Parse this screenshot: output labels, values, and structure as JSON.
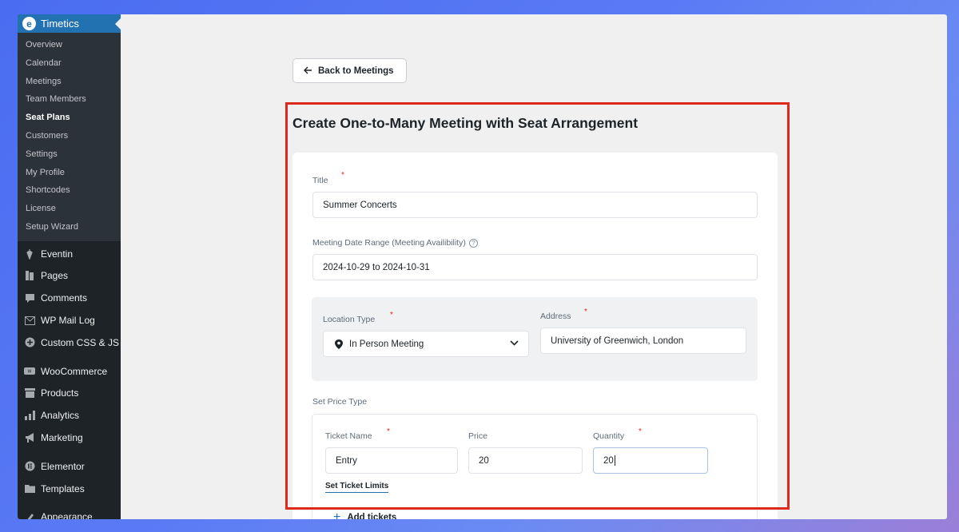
{
  "sidebar": {
    "brand": "Timetics",
    "submenu": [
      {
        "label": "Overview",
        "active": false
      },
      {
        "label": "Calendar",
        "active": false
      },
      {
        "label": "Meetings",
        "active": false
      },
      {
        "label": "Team Members",
        "active": false
      },
      {
        "label": "Seat Plans",
        "active": true
      },
      {
        "label": "Customers",
        "active": false
      },
      {
        "label": "Settings",
        "active": false
      },
      {
        "label": "My Profile",
        "active": false
      },
      {
        "label": "Shortcodes",
        "active": false
      },
      {
        "label": "License",
        "active": false
      },
      {
        "label": "Setup Wizard",
        "active": false
      }
    ],
    "menu": [
      {
        "label": "Eventin",
        "icon": "eventin-icon"
      },
      {
        "label": "Pages",
        "icon": "pages-icon"
      },
      {
        "label": "Comments",
        "icon": "comments-icon"
      },
      {
        "label": "WP Mail Log",
        "icon": "mail-icon"
      },
      {
        "label": "Custom CSS & JS",
        "icon": "plus-circle-icon"
      },
      {
        "label": "WooCommerce",
        "icon": "woocommerce-icon"
      },
      {
        "label": "Products",
        "icon": "products-icon"
      },
      {
        "label": "Analytics",
        "icon": "analytics-icon"
      },
      {
        "label": "Marketing",
        "icon": "megaphone-icon"
      },
      {
        "label": "Elementor",
        "icon": "elementor-icon"
      },
      {
        "label": "Templates",
        "icon": "folder-icon"
      },
      {
        "label": "Appearance",
        "icon": "brush-icon"
      }
    ]
  },
  "main": {
    "back_button": "Back to Meetings",
    "title": "Create One-to-Many Meeting with Seat Arrangement",
    "form": {
      "title_label": "Title",
      "title_value": "Summer Concerts",
      "date_label": "Meeting Date Range (Meeting Availibility)",
      "date_value": "2024-10-29 to 2024-10-31",
      "location_type_label": "Location Type",
      "location_type_value": "In Person Meeting",
      "address_label": "Address",
      "address_value": "University of Greenwich, London",
      "price_type_label": "Set Price Type",
      "ticket_name_label": "Ticket Name",
      "ticket_name_value": "Entry",
      "price_label": "Price",
      "price_value": "20",
      "quantity_label": "Quantity",
      "quantity_value": "20",
      "ticket_limits_link": "Set Ticket Limits",
      "add_tickets": "Add tickets",
      "required_mark": "*",
      "info_mark": "?"
    }
  },
  "colors": {
    "accent": "#2271b1",
    "sidebar_bg": "#1d2327",
    "highlight": "#e0291d"
  }
}
